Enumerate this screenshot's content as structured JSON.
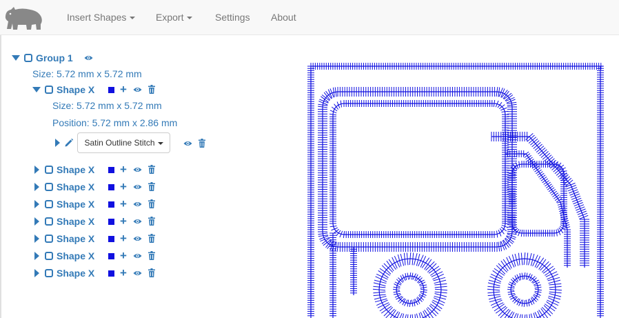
{
  "nav": {
    "items": [
      {
        "label": "Insert Shapes",
        "dropdown": true
      },
      {
        "label": "Export",
        "dropdown": true
      },
      {
        "label": "Settings",
        "dropdown": false
      },
      {
        "label": "About",
        "dropdown": false
      }
    ]
  },
  "tree": {
    "group": {
      "label": "Group 1",
      "size_text": "Size: 5.72 mm x 5.72 mm"
    },
    "expanded_shape": {
      "label": "Shape X",
      "size_text": "Size: 5.72 mm x 5.72 mm",
      "position_text": "Position: 5.72 mm x 2.86 mm",
      "stitch_type": "Satin Outline Stitch"
    },
    "collapsed_shapes": [
      {
        "label": "Shape X"
      },
      {
        "label": "Shape X"
      },
      {
        "label": "Shape X"
      },
      {
        "label": "Shape X"
      },
      {
        "label": "Shape X"
      },
      {
        "label": "Shape X"
      },
      {
        "label": "Shape X"
      }
    ]
  },
  "colors": {
    "accent": "#337ab7",
    "stitch": "#1010e0",
    "navbar_bg": "#f8f8f8",
    "nav_text": "#777777"
  },
  "icons": {
    "brand": "bear-logo-icon",
    "visibility": "eye-icon",
    "delete": "trash-icon",
    "edit": "pencil-icon",
    "color": "color-swatch-icon",
    "add": "plus-icon"
  }
}
